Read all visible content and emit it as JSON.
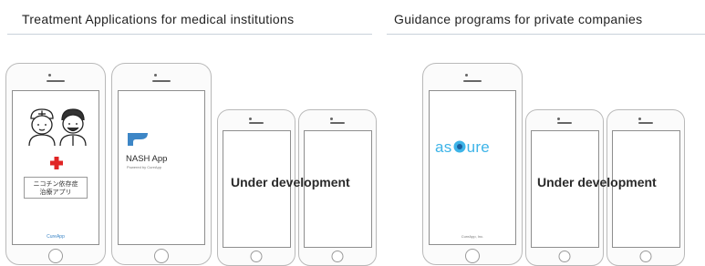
{
  "sections": {
    "medical_title": "Treatment Applications for medical institutions",
    "private_title": "Guidance programs for private companies"
  },
  "apps": {
    "cureapp": {
      "label_line1": "ニコチン依存症",
      "label_line2": "治療アプリ",
      "brand": "CureApp"
    },
    "nash": {
      "name": "NASH App",
      "tagline": "Powered by CureApp"
    },
    "ascure": {
      "name_before": "as",
      "name_after": "ure",
      "footer": "CureApp, Inc."
    }
  },
  "status": {
    "medical_dev": "Under development",
    "private_dev": "Under development"
  },
  "colors": {
    "cross_red": "#e02424",
    "nash_blue": "#3d86c6",
    "ascure_blue": "#3db4e8"
  }
}
